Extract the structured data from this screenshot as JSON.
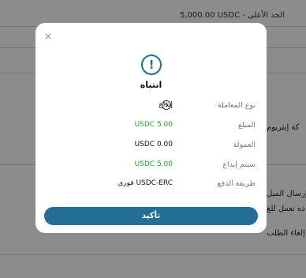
{
  "background": {
    "top_limit": "5,000.00 USDC - الحد الأعلى",
    "network_fragment": "كة إيثريوم",
    "send_fragment": "إرسال المبل",
    "note_fragment": "ذه تعمل للغ",
    "cancel_fragment": "إلغاء الطلب"
  },
  "modal": {
    "title": "انتباه",
    "close_icon": "×",
    "alert_icon": "!",
    "rows": [
      {
        "label": "نوع المعاملة",
        "value": "إيداع",
        "icon": "plus-circle-icon"
      },
      {
        "label": "المبلغ",
        "value": "USDC 5.00",
        "color": "#23a131"
      },
      {
        "label": "العمولة",
        "value": "USDC 0.00"
      },
      {
        "label": "سيتم إيداع",
        "value": "USDC 5.00",
        "color": "#23a131"
      },
      {
        "label": "طريقة الدفع",
        "value": "USDC-ERC فوري"
      }
    ],
    "confirm_label": "تأكيد"
  },
  "colors": {
    "accent": "#236f93",
    "positive": "#23a131",
    "overlay": "rgba(0,0,0,0.45)"
  }
}
